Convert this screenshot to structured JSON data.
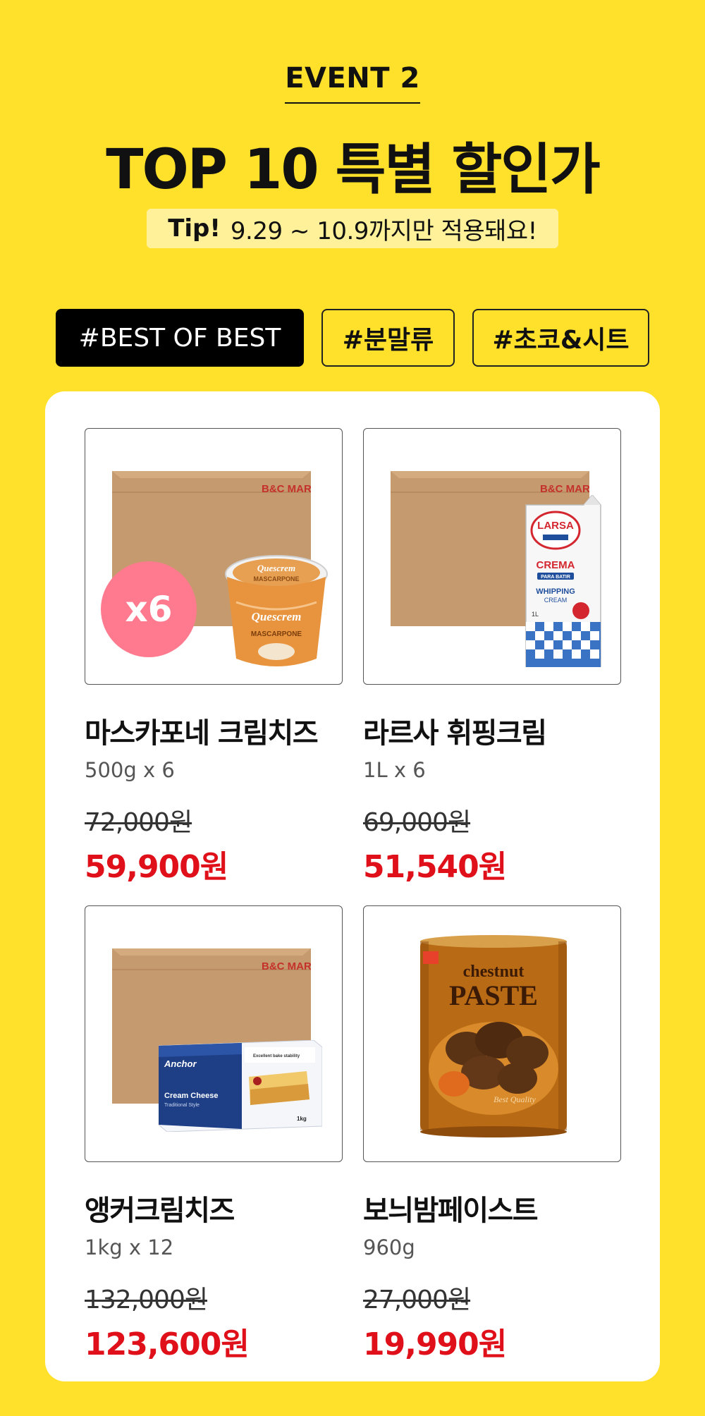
{
  "header": {
    "event_label": "EVENT 2",
    "title": "TOP 10 특별 할인가",
    "tip_label": "Tip!",
    "tip_text": "9.29 ~ 10.9까지만 적용돼요!"
  },
  "tabs": [
    {
      "label": "#BEST OF BEST",
      "active": true
    },
    {
      "label": "#분말류",
      "active": false
    },
    {
      "label": "#초코&시트",
      "active": false
    }
  ],
  "products": [
    {
      "name": "마스카포네 크림치즈",
      "spec": "500g x 6",
      "original_price": "72,000원",
      "sale_price": "59,900원",
      "badge": "x6"
    },
    {
      "name": "라르사 휘핑크림",
      "spec": "1L x 6",
      "original_price": "69,000원",
      "sale_price": "51,540원"
    },
    {
      "name": "앵커크림치즈",
      "spec": "1kg x 12",
      "original_price": "132,000원",
      "sale_price": "123,600원"
    },
    {
      "name": "보늬밤페이스트",
      "spec": "960g",
      "original_price": "27,000원",
      "sale_price": "19,990원"
    }
  ],
  "images": {
    "box_logo": "B&C MARKET",
    "larsa_brand": "LARSA",
    "larsa_crema": "CREMA",
    "larsa_para": "PARA BATIR",
    "larsa_whipping": "WHIPPING",
    "larsa_cream": "CREAM",
    "larsa_volume": "1L",
    "anchor_brand": "Anchor",
    "anchor_product": "Cream Cheese",
    "anchor_sub": "Traditional Style",
    "anchor_weight": "1kg",
    "anchor_bake": "Excellent bake stability",
    "chestnut_word": "chestnut",
    "chestnut_paste": "PASTE",
    "chestnut_quality": "Best Quality",
    "quescrem": "Quescrem",
    "mascarpone": "MASCARPONE"
  },
  "colors": {
    "background": "#FFE02A",
    "sale_price": "#E0101A",
    "badge": "#FF7A8E",
    "tip_box": "#FFF19A"
  }
}
